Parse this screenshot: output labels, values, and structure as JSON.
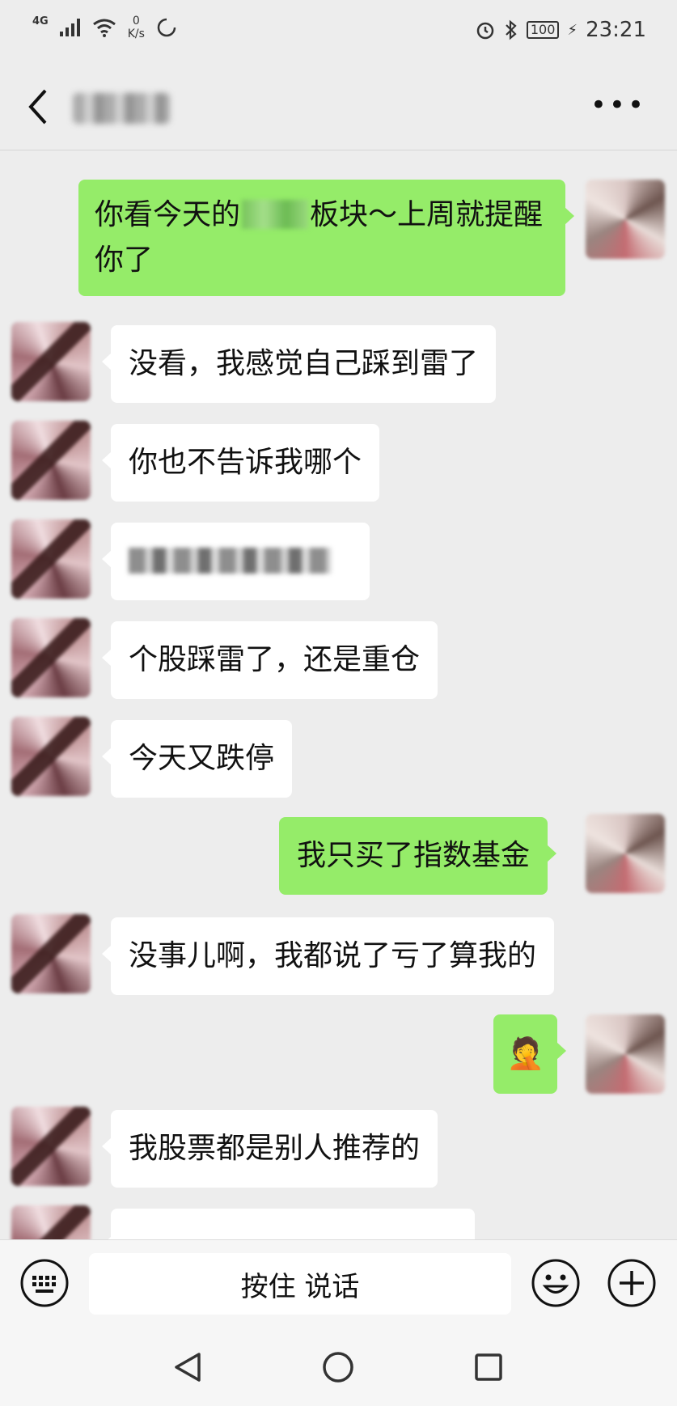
{
  "status_bar": {
    "network": "4G",
    "speed_value": "0",
    "speed_unit": "K/s",
    "battery": "100",
    "time": "23:21"
  },
  "input_bar": {
    "hold_to_talk_label": "按住 说话"
  },
  "messages": [
    {
      "side": "out",
      "text_before": "你看今天的",
      "text_after": "板块～上周就提醒你了"
    },
    {
      "side": "in",
      "text": "没看，我感觉自己踩到雷了"
    },
    {
      "side": "in",
      "text": "你也不告诉我哪个"
    },
    {
      "side": "in",
      "text": ""
    },
    {
      "side": "in",
      "text": "个股踩雷了，还是重仓"
    },
    {
      "side": "in",
      "text": "今天又跌停"
    },
    {
      "side": "out",
      "text": "我只买了指数基金"
    },
    {
      "side": "in",
      "text": "没事儿啊，我都说了亏了算我的"
    },
    {
      "side": "out",
      "text": "🤦"
    },
    {
      "side": "in",
      "text": "我股票都是别人推荐的"
    }
  ],
  "colors": {
    "outgoing_bubble": "#95ec69",
    "incoming_bubble": "#ffffff",
    "chat_background": "#ededed"
  }
}
